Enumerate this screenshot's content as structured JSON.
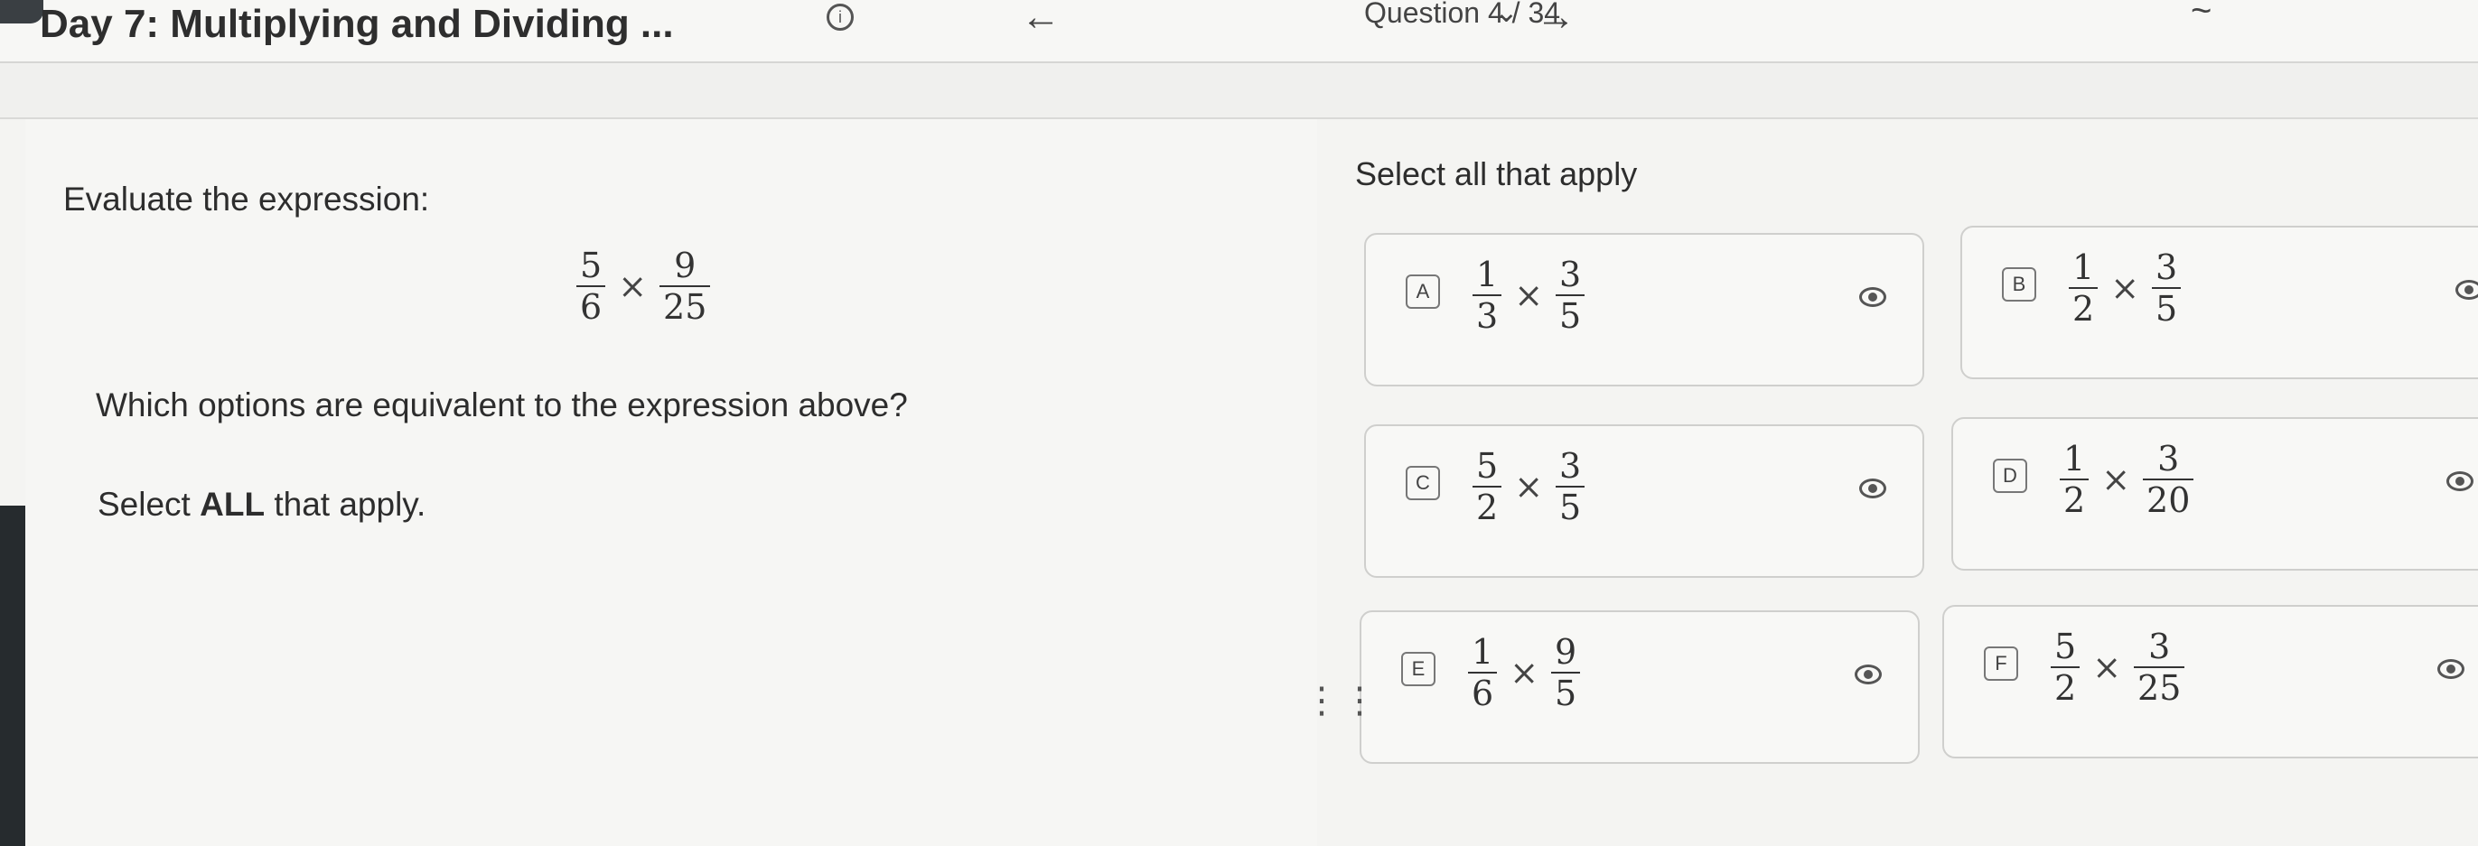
{
  "header": {
    "title": "Day 7: Multiplying and Dividing ...",
    "info_icon": "i",
    "back_icon": "←",
    "next_icon": "→",
    "question_indicator": "Question 4 / 34",
    "chevron_icon": "chevron-down-icon",
    "tilde_icon": "~"
  },
  "prompt": {
    "evaluate": "Evaluate the expression:",
    "expression": {
      "left": {
        "num": "5",
        "den": "6"
      },
      "op": "×",
      "right": {
        "num": "9",
        "den": "25"
      }
    },
    "question": "Which options are equivalent to the expression above?",
    "select_prefix": "Select ",
    "select_bold": "ALL",
    "select_suffix": " that apply."
  },
  "answers": {
    "header": "Select all that apply",
    "options": [
      {
        "letter": "A",
        "a": {
          "num": "1",
          "den": "3"
        },
        "op": "×",
        "b": {
          "num": "3",
          "den": "5"
        }
      },
      {
        "letter": "B",
        "a": {
          "num": "1",
          "den": "2"
        },
        "op": "×",
        "b": {
          "num": "3",
          "den": "5"
        }
      },
      {
        "letter": "C",
        "a": {
          "num": "5",
          "den": "2"
        },
        "op": "×",
        "b": {
          "num": "3",
          "den": "5"
        }
      },
      {
        "letter": "D",
        "a": {
          "num": "1",
          "den": "2"
        },
        "op": "×",
        "b": {
          "num": "3",
          "den": "20"
        }
      },
      {
        "letter": "E",
        "a": {
          "num": "1",
          "den": "6"
        },
        "op": "×",
        "b": {
          "num": "9",
          "den": "5"
        }
      },
      {
        "letter": "F",
        "a": {
          "num": "5",
          "den": "2"
        },
        "op": "×",
        "b": {
          "num": "3",
          "den": "25"
        }
      }
    ]
  },
  "drag_handle_icon": "drag-handle-icon"
}
